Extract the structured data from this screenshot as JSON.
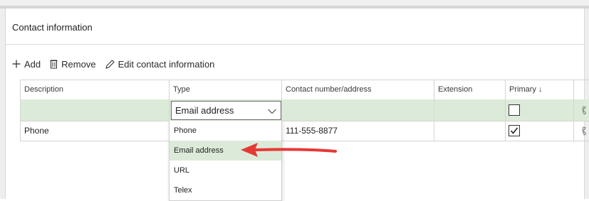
{
  "section": {
    "title": "Contact information"
  },
  "toolbar": {
    "add_label": "Add",
    "remove_label": "Remove",
    "edit_label": "Edit contact information"
  },
  "grid": {
    "columns": [
      "Description",
      "Type",
      "Contact number/address",
      "Extension",
      "Primary ↓"
    ],
    "rows": [
      {
        "description": "",
        "type": "Email address",
        "contact": "",
        "extension": "",
        "primary": false,
        "selected": true
      },
      {
        "description": "Phone",
        "type": "",
        "contact": "111-555-8877",
        "extension": "",
        "primary": true,
        "selected": false
      }
    ]
  },
  "type_dropdown": {
    "selected": "Email address",
    "options": [
      "Phone",
      "Email address",
      "URL",
      "Telex"
    ]
  },
  "icons": {
    "add": "plus-icon",
    "remove": "trash-icon",
    "edit": "pencil-icon",
    "dropdown": "chevron-down-icon",
    "row_action": "phone-icon",
    "annotation": "red-arrow"
  },
  "colors": {
    "selected_row": "#dcebd9",
    "accent_arrow": "#e53935",
    "border": "#d4d4d4"
  }
}
